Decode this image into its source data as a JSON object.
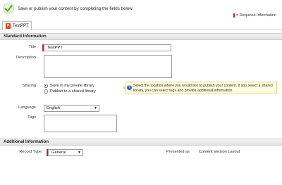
{
  "header": {
    "message": "Save or publish your content by completing the fields below.",
    "required_note": "= Required Information"
  },
  "tab": {
    "label": "TestPPT",
    "icon": "ppt-file-icon"
  },
  "standard_section": {
    "title": "Standard Information",
    "title_label": "Title",
    "title_value": "TestPPT",
    "description_label": "Description",
    "description_value": "",
    "sharing_label": "Sharing",
    "sharing_options": [
      {
        "label": "Save in my private library",
        "checked": true
      },
      {
        "label": "Publish to a shared library",
        "checked": false
      }
    ],
    "sharing_help": "Select the location where you would like to publish your content. If you select a shared library, you can select tags and provide additional information.",
    "language_label": "Language",
    "language_value": "English",
    "tags_label": "Tags",
    "tags_value": ""
  },
  "additional_section": {
    "title": "Additional Information",
    "record_type_label": "Record Type",
    "record_type_value": "General",
    "presented_as_label": "Presented as",
    "presented_as_value": "Content Version Layout"
  },
  "colors": {
    "required": "#c0263f",
    "accent": "#2f6bc4",
    "check": "#4caf2a"
  }
}
